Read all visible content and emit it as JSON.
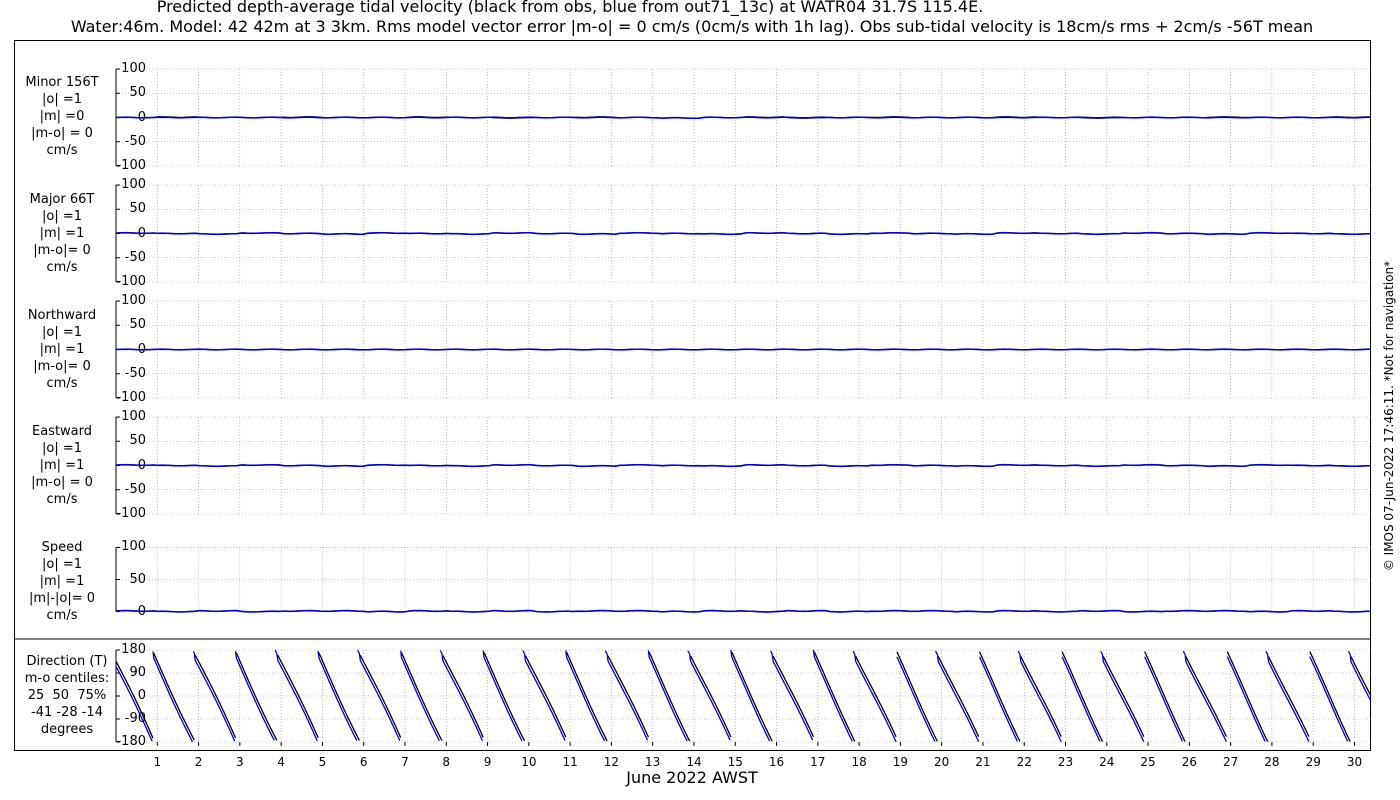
{
  "title_line1": "Predicted depth-average tidal velocity (black from obs, blue from out71_13c) at WATR04 31.7S 115.4E.",
  "title_line2": "Water:46m. Model: 42 42m at 3 3km. Rms model vector error |m-o| = 0 cm/s (0cm/s with 1h lag). Obs sub-tidal velocity is 18cm/s rms + 2cm/s -56T mean",
  "xlabel": "June 2022 AWST",
  "copyright": "© IMOS 07-Jun-2022 17:46:11. *Not for navigation*",
  "chart_data": [
    {
      "type": "line",
      "label_lines": [
        "Minor 156T",
        "|o| =1",
        "|m| =0",
        "|m-o| = 0",
        "cm/s"
      ],
      "ylim": [
        -100,
        100
      ],
      "yticks": [
        "100",
        "50",
        "0",
        "-50",
        "-100"
      ],
      "series": [
        {
          "color": "#000000",
          "values": [
            0,
            1,
            0,
            0,
            1,
            0,
            0,
            1,
            0,
            -1,
            0,
            1,
            0,
            -1,
            0,
            1,
            -1,
            0,
            1,
            0,
            0,
            1,
            0,
            -1,
            0,
            0,
            1,
            0,
            0,
            1
          ]
        },
        {
          "color": "#0000cc",
          "values": [
            0,
            0,
            0,
            0,
            0,
            0,
            0,
            0,
            0,
            0,
            0,
            0,
            0,
            -1,
            0,
            0,
            0,
            0,
            0,
            0,
            0,
            0,
            0,
            0,
            0,
            0,
            0,
            0,
            0,
            0
          ]
        }
      ]
    },
    {
      "type": "line",
      "label_lines": [
        "Major 66T",
        "|o| =1",
        "|m| =1",
        "|m-o|= 0",
        "cm/s"
      ],
      "ylim": [
        -100,
        100
      ],
      "yticks": [
        "100",
        "50",
        "0",
        "-50",
        "-100"
      ],
      "series": [
        {
          "color": "#000000",
          "values": [
            1,
            0,
            -1,
            1,
            0,
            -1,
            1,
            0,
            -1,
            1,
            0,
            -1,
            1,
            0,
            -1,
            1,
            0,
            -1,
            1,
            0,
            -1,
            1,
            0,
            -1,
            1,
            0,
            -1,
            1,
            0,
            -1
          ]
        },
        {
          "color": "#0000cc",
          "values": [
            1,
            0,
            -1,
            1,
            0,
            -1,
            1,
            0,
            -1,
            1,
            0,
            -1,
            1,
            0,
            -1,
            1,
            0,
            -1,
            1,
            0,
            -1,
            1,
            0,
            -1,
            1,
            0,
            -1,
            1,
            0,
            -1
          ]
        }
      ]
    },
    {
      "type": "line",
      "label_lines": [
        "Northward",
        "|o| =1",
        "|m| =1",
        "|m-o|= 0",
        "cm/s"
      ],
      "ylim": [
        -100,
        100
      ],
      "yticks": [
        "100",
        "50",
        "0",
        "-50",
        "-100"
      ],
      "series": [
        {
          "color": "#000000",
          "values": [
            0,
            0,
            0,
            0,
            0,
            0,
            0,
            0,
            0,
            0,
            0,
            0,
            0,
            0,
            0,
            0,
            0,
            0,
            0,
            0,
            0,
            0,
            0,
            0,
            0,
            0,
            0,
            0,
            0,
            0
          ]
        },
        {
          "color": "#0000cc",
          "values": [
            0,
            0,
            0,
            0,
            0,
            0,
            0,
            0,
            0,
            0,
            0,
            0,
            0,
            0,
            0,
            0,
            0,
            0,
            0,
            0,
            0,
            0,
            0,
            0,
            0,
            0,
            0,
            0,
            0,
            0
          ]
        }
      ]
    },
    {
      "type": "line",
      "label_lines": [
        "Eastward",
        "|o| =1",
        "|m| =1",
        "|m-o| = 0",
        "cm/s"
      ],
      "ylim": [
        -100,
        100
      ],
      "yticks": [
        "100",
        "50",
        "0",
        "-50",
        "-100"
      ],
      "series": [
        {
          "color": "#000000",
          "values": [
            1,
            0,
            -1,
            1,
            0,
            -1,
            1,
            0,
            -1,
            1,
            0,
            -1,
            1,
            0,
            -1,
            1,
            0,
            -1,
            1,
            0,
            -1,
            1,
            0,
            -1,
            1,
            0,
            -1,
            1,
            0,
            -1
          ]
        },
        {
          "color": "#0000cc",
          "values": [
            1,
            0,
            -1,
            1,
            0,
            -1,
            1,
            0,
            -1,
            1,
            0,
            -1,
            1,
            0,
            -1,
            1,
            0,
            -1,
            1,
            0,
            -1,
            1,
            0,
            -1,
            1,
            0,
            -1,
            1,
            0,
            -1
          ]
        }
      ]
    },
    {
      "type": "line",
      "label_lines": [
        "Speed",
        "|o| =1",
        "|m| =1",
        "|m|-|o|= 0",
        "cm/s"
      ],
      "ylim": [
        -10,
        110
      ],
      "yticks": [
        "100",
        "50",
        "0"
      ],
      "series": [
        {
          "color": "#000000",
          "values": [
            1,
            0,
            1,
            0,
            1,
            1,
            0,
            1,
            0,
            1,
            0,
            1,
            1,
            0,
            1,
            0,
            1,
            0,
            1,
            1,
            0,
            1,
            0,
            1,
            0,
            1,
            1,
            0,
            1,
            0
          ]
        },
        {
          "color": "#0000cc",
          "values": [
            1,
            0,
            1,
            0,
            1,
            1,
            0,
            1,
            0,
            1,
            0,
            1,
            1,
            0,
            1,
            0,
            1,
            0,
            1,
            1,
            0,
            1,
            0,
            1,
            0,
            1,
            1,
            0,
            1,
            0
          ]
        }
      ]
    },
    {
      "type": "line",
      "label_lines": [
        "Direction (T)",
        "m-o centiles:",
        "25  50  75%",
        "-41 -28 -14",
        "degrees"
      ],
      "ylim": [
        -180,
        180
      ],
      "yticks": [
        "180",
        "90",
        "0",
        "-90",
        "-180"
      ],
      "x_range_days": [
        0,
        30.4
      ],
      "series": [
        {
          "color": "#000000",
          "name": "obs"
        },
        {
          "color": "#0000cc",
          "name": "model"
        }
      ]
    }
  ],
  "x_ticks": [
    "1",
    "2",
    "3",
    "4",
    "5",
    "6",
    "7",
    "8",
    "9",
    "10",
    "11",
    "12",
    "13",
    "14",
    "15",
    "16",
    "17",
    "18",
    "19",
    "20",
    "21",
    "22",
    "23",
    "24",
    "25",
    "26",
    "27",
    "28",
    "29",
    "30"
  ]
}
